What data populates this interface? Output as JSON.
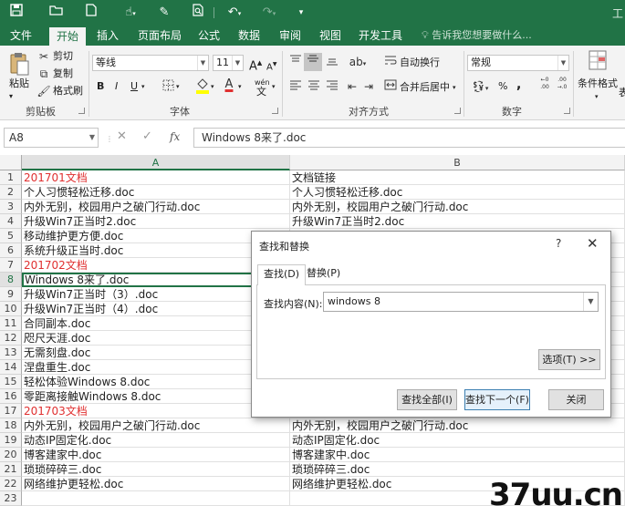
{
  "window": {
    "title_fragment": "工"
  },
  "quick_access": {
    "icons": [
      "save-icon",
      "open-icon",
      "new-icon",
      "touch-mode-icon",
      "format-painter-icon",
      "print-preview-icon",
      "undo-icon",
      "redo-icon",
      "customize-icon"
    ]
  },
  "ribbon_tabs": [
    "文件",
    "开始",
    "插入",
    "页面布局",
    "公式",
    "数据",
    "审阅",
    "视图",
    "开发工具"
  ],
  "active_tab": "开始",
  "tell_me": "告诉我您想要做什么...",
  "clipboard": {
    "paste": "粘贴",
    "cut": "剪切",
    "copy": "复制",
    "format_painter": "格式刷",
    "label": "剪贴板"
  },
  "font": {
    "name": "等线",
    "size": "11",
    "bold": "B",
    "italic": "I",
    "underline": "U",
    "label": "字体",
    "grow": "A",
    "shrink": "A",
    "color_letter": "A",
    "wen": "wén",
    "colors": {
      "highlight": "#ffff00",
      "font": "#e03030"
    }
  },
  "alignment": {
    "wrap": "自动换行",
    "merge": "合并后居中",
    "label": "对齐方式"
  },
  "number": {
    "format": "常规",
    "label": "数字",
    "percent": "%",
    "comma": ",",
    "inc_dec": ".0\n.00"
  },
  "styles": {
    "conditional": "条件格式",
    "table_partial": "表"
  },
  "formula_bar": {
    "name_box": "A8",
    "cancel": "✕",
    "enter": "✓",
    "fx": "fx",
    "content": "Windows 8来了.doc"
  },
  "columns": [
    "A",
    "B"
  ],
  "rows": [
    {
      "n": "1",
      "a": "201701文档",
      "b": "文档链接",
      "a_red": true
    },
    {
      "n": "2",
      "a": "个人习惯轻松迁移.doc",
      "b": "个人习惯轻松迁移.doc"
    },
    {
      "n": "3",
      "a": "内外无别，校园用户之破门行动.doc",
      "b": "内外无别，校园用户之破门行动.doc"
    },
    {
      "n": "4",
      "a": "升级Win7正当时2.doc",
      "b": "升级Win7正当时2.doc"
    },
    {
      "n": "5",
      "a": "移动维护更方便.doc",
      "b": ""
    },
    {
      "n": "6",
      "a": "系统升级正当时.doc",
      "b": ""
    },
    {
      "n": "7",
      "a": "201702文档",
      "b": "",
      "a_red": true
    },
    {
      "n": "8",
      "a": "Windows 8来了.doc",
      "b": ""
    },
    {
      "n": "9",
      "a": "升级Win7正当时（3）.doc",
      "b": ""
    },
    {
      "n": "10",
      "a": "升级Win7正当时（4）.doc",
      "b": ""
    },
    {
      "n": "11",
      "a": "合同副本.doc",
      "b": ""
    },
    {
      "n": "12",
      "a": "咫尺天涯.doc",
      "b": ""
    },
    {
      "n": "13",
      "a": "无需刻盘.doc",
      "b": ""
    },
    {
      "n": "14",
      "a": "涅盘重生.doc",
      "b": ""
    },
    {
      "n": "15",
      "a": "轻松体验Windows 8.doc",
      "b": ""
    },
    {
      "n": "16",
      "a": "零距离接触Windows 8.doc",
      "b": ""
    },
    {
      "n": "17",
      "a": "201703文档",
      "b": "",
      "a_red": true
    },
    {
      "n": "18",
      "a": "内外无别，校园用户之破门行动.doc",
      "b": "内外无别，校园用户之破门行动.doc"
    },
    {
      "n": "19",
      "a": "动态IP固定化.doc",
      "b": "动态IP固定化.doc"
    },
    {
      "n": "20",
      "a": "博客建家中.doc",
      "b": "博客建家中.doc"
    },
    {
      "n": "21",
      "a": "琐琐碎碎三.doc",
      "b": "琐琐碎碎三.doc"
    },
    {
      "n": "22",
      "a": "网络维护更轻松.doc",
      "b": "网络维护更轻松.doc"
    },
    {
      "n": "23",
      "a": "",
      "b": ""
    }
  ],
  "active_cell": "A8",
  "dialog": {
    "title": "查找和替换",
    "help": "?",
    "close": "✕",
    "tab_find": "查找(D)",
    "tab_replace": "替换(P)",
    "find_label": "查找内容(N):",
    "find_value": "windows 8",
    "options_button": "选项(T) >>",
    "find_all_button": "查找全部(I)",
    "find_next_button": "查找下一个(F)",
    "close_button": "关闭"
  },
  "watermark": "37uu.cn"
}
